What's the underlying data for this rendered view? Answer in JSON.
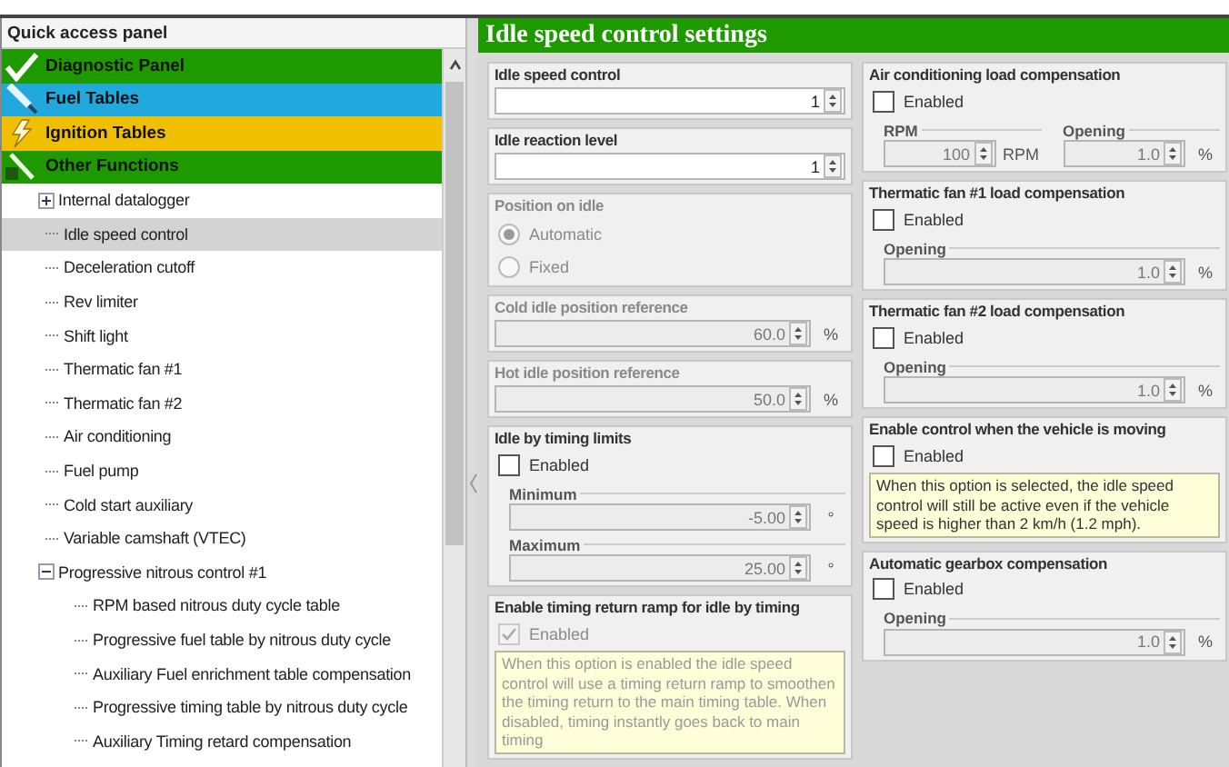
{
  "quick_access": {
    "title": "Quick access panel",
    "categories": [
      {
        "label": "Diagnostic Panel",
        "color": "#1e9a00",
        "kind": "check"
      },
      {
        "label": "Fuel Tables",
        "color": "#21a8dc",
        "kind": "injector"
      },
      {
        "label": "Ignition Tables",
        "color": "#f0c000",
        "kind": "spark"
      },
      {
        "label": "Other Functions",
        "color": "#1e9a00",
        "kind": "wand"
      }
    ],
    "tree": [
      {
        "label": "Internal datalogger",
        "selected": false,
        "expanded": false
      },
      {
        "label": "Idle speed control",
        "selected": true
      },
      {
        "label": "Deceleration cutoff",
        "selected": false
      },
      {
        "label": "Rev limiter",
        "selected": false
      },
      {
        "label": "Shift light",
        "selected": false
      },
      {
        "label": "Thermatic fan #1",
        "selected": false
      },
      {
        "label": "Thermatic fan #2",
        "selected": false
      },
      {
        "label": "Air conditioning",
        "selected": false
      },
      {
        "label": "Fuel pump",
        "selected": false
      },
      {
        "label": "Cold start auxiliary",
        "selected": false
      },
      {
        "label": "Variable camshaft (VTEC)",
        "selected": false
      },
      {
        "label": "Progressive nitrous control #1",
        "selected": false,
        "expanded": true,
        "children": [
          {
            "label": "RPM based nitrous duty cycle table",
            "selected": false
          },
          {
            "label": "Progressive fuel table by nitrous duty cycle",
            "selected": false
          },
          {
            "label": "Auxiliary Fuel enrichment table compensation",
            "selected": false
          },
          {
            "label": "Progressive timing table by nitrous duty cycle",
            "selected": false
          },
          {
            "label": "Auxiliary Timing retard compensation",
            "selected": false
          }
        ]
      }
    ]
  },
  "settings": {
    "title": "Idle speed control settings",
    "columns": [
      [
        {
          "kind": "spin",
          "title": "Idle speed control",
          "value": "1",
          "disabled": false
        },
        {
          "kind": "spin",
          "title": "Idle reaction level",
          "value": "1",
          "disabled": false
        },
        {
          "kind": "radio",
          "title": "Position on idle",
          "disabled": true,
          "options": [
            {
              "label": "Automatic",
              "selected": true
            },
            {
              "label": "Fixed",
              "selected": false
            }
          ]
        },
        {
          "kind": "spin",
          "title": "Cold idle position reference",
          "value": "60.0",
          "unit": "%",
          "disabled": true
        },
        {
          "kind": "spin",
          "title": "Hot idle position reference",
          "value": "50.0",
          "unit": "%",
          "disabled": true
        },
        {
          "kind": "check",
          "title": "Idle by timing limits",
          "checkbox": {
            "label": "Enabled",
            "checked": false,
            "disabled": false
          },
          "fields": [
            {
              "label": "Minimum",
              "value": "-5.00",
              "unit": "°"
            },
            {
              "label": "Maximum",
              "value": "25.00",
              "unit": "°"
            }
          ]
        },
        {
          "kind": "check",
          "title": "Enable timing return ramp for idle by timing",
          "checkbox": {
            "label": "Enabled",
            "checked": true,
            "disabled": true
          },
          "note": "When this option is enabled the idle speed control will use a timing return ramp to smoothen the timing return to the main timing table. When disabled, timing instantly goes back to main timing"
        }
      ],
      [
        {
          "kind": "check",
          "title": "Air conditioning load compensation",
          "checkbox": {
            "label": "Enabled",
            "checked": false,
            "disabled": false
          },
          "fields": [
            {
              "label": "RPM",
              "value": "100",
              "unit": "RPM"
            },
            {
              "label": "Opening",
              "value": "1.0",
              "unit": "%"
            }
          ]
        },
        {
          "kind": "check",
          "title": "Thermatic fan #1 load compensation",
          "checkbox": {
            "label": "Enabled",
            "checked": false,
            "disabled": false
          },
          "fields": [
            {
              "label": "Opening",
              "value": "1.0",
              "unit": "%"
            }
          ]
        },
        {
          "kind": "check",
          "title": "Thermatic fan #2 load compensation",
          "checkbox": {
            "label": "Enabled",
            "checked": false,
            "disabled": false
          },
          "fields": [
            {
              "label": "Opening",
              "value": "1.0",
              "unit": "%"
            }
          ]
        },
        {
          "kind": "check",
          "title": "Enable control when the vehicle is moving",
          "checkbox": {
            "label": "Enabled",
            "checked": false,
            "disabled": false
          },
          "note": "When this option is selected, the idle speed control will still be active even if the vehicle speed is higher than 2 km/h (1.2 mph)."
        },
        {
          "kind": "check",
          "title": "Automatic gearbox compensation",
          "checkbox": {
            "label": "Enabled",
            "checked": false,
            "disabled": false
          },
          "fields": [
            {
              "label": "Opening",
              "value": "1.0",
              "unit": "%"
            }
          ]
        }
      ]
    ]
  }
}
